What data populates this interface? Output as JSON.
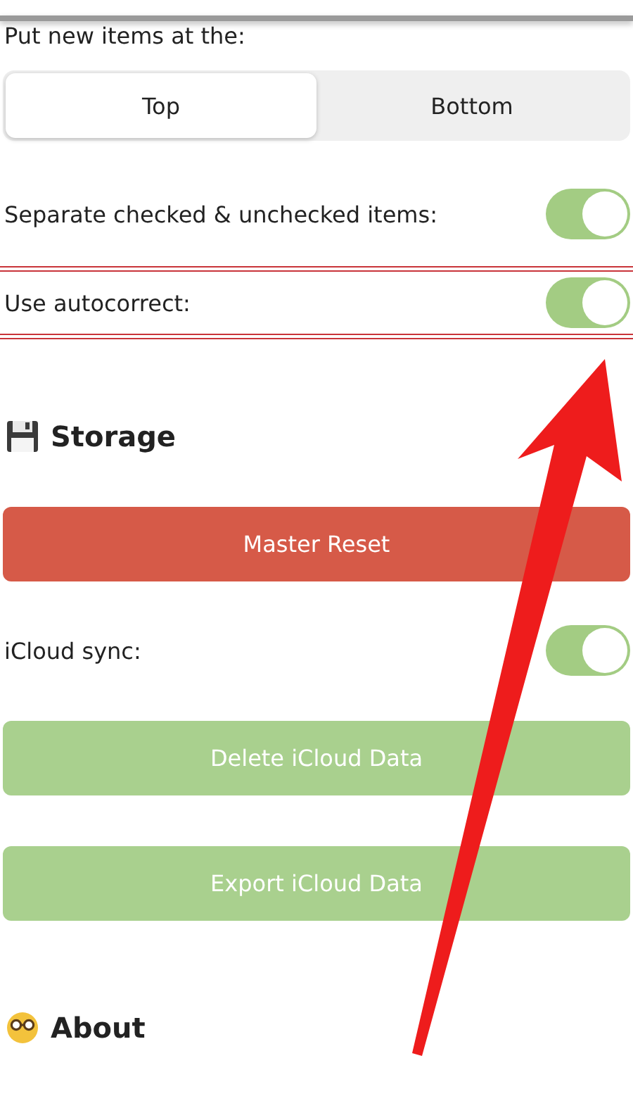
{
  "placement": {
    "label": "Put new items at the:",
    "options": [
      {
        "label": "Top",
        "selected": true
      },
      {
        "label": "Bottom",
        "selected": false
      }
    ]
  },
  "toggles": [
    {
      "label": "Separate checked & unchecked items:",
      "on": true,
      "highlighted": false
    },
    {
      "label": "Use autocorrect:",
      "on": true,
      "highlighted": true
    }
  ],
  "storage": {
    "title": "Storage",
    "items": [
      {
        "kind": "button",
        "label": "Master Reset",
        "color": "#d65a48"
      },
      {
        "kind": "toggle",
        "label": "iCloud sync:",
        "on": true
      },
      {
        "kind": "button",
        "label": "Delete iCloud Data",
        "color": "#a9d08e"
      },
      {
        "kind": "button",
        "label": "Export iCloud Data",
        "color": "#a9d08e"
      }
    ]
  },
  "about": {
    "title": "About"
  }
}
